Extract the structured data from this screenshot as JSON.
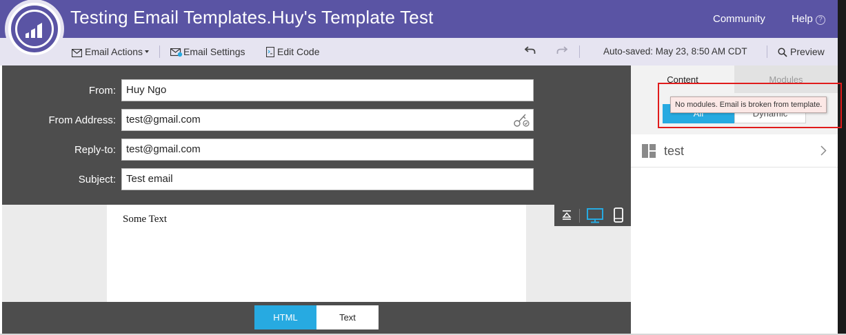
{
  "header": {
    "title": "Testing Email Templates.Huy's Template Test",
    "community_label": "Community",
    "help_label": "Help",
    "help_icon_glyph": "?",
    "brand_color": "#5a54a4"
  },
  "toolbar": {
    "email_actions_label": "Email Actions",
    "email_settings_label": "Email Settings",
    "edit_code_label": "Edit Code",
    "autosaved_text": "Auto-saved: May 23, 8:50 AM CDT",
    "preview_label": "Preview",
    "icons": [
      "envelope-icon",
      "email-settings-icon",
      "code-file-icon",
      "undo-icon",
      "redo-icon",
      "search-icon"
    ]
  },
  "form": {
    "from_label": "From:",
    "from_value": "Huy Ngo",
    "from_address_label": "From Address:",
    "from_address_value": "test@gmail.com",
    "reply_to_label": "Reply-to:",
    "reply_to_value": "test@gmail.com",
    "subject_label": "Subject:",
    "subject_value": "Test email"
  },
  "canvas": {
    "body_text": "Some Text",
    "view_tools": [
      "collapse-header-icon",
      "desktop-icon",
      "mobile-icon"
    ]
  },
  "bottom_tabs": {
    "html_label": "HTML",
    "text_label": "Text",
    "active": "HTML"
  },
  "right_panel": {
    "tab_content": "Content",
    "tab_modules": "Modules",
    "segment_all": "All",
    "segment_dynamic": "Dynamic",
    "items": [
      {
        "label": "test"
      }
    ]
  },
  "tooltip": {
    "text": "No modules. Email is broken from template."
  },
  "colors": {
    "accent": "#27aae1",
    "dark_panel": "#4d4d4d",
    "highlight_box": "#e01b1b"
  }
}
